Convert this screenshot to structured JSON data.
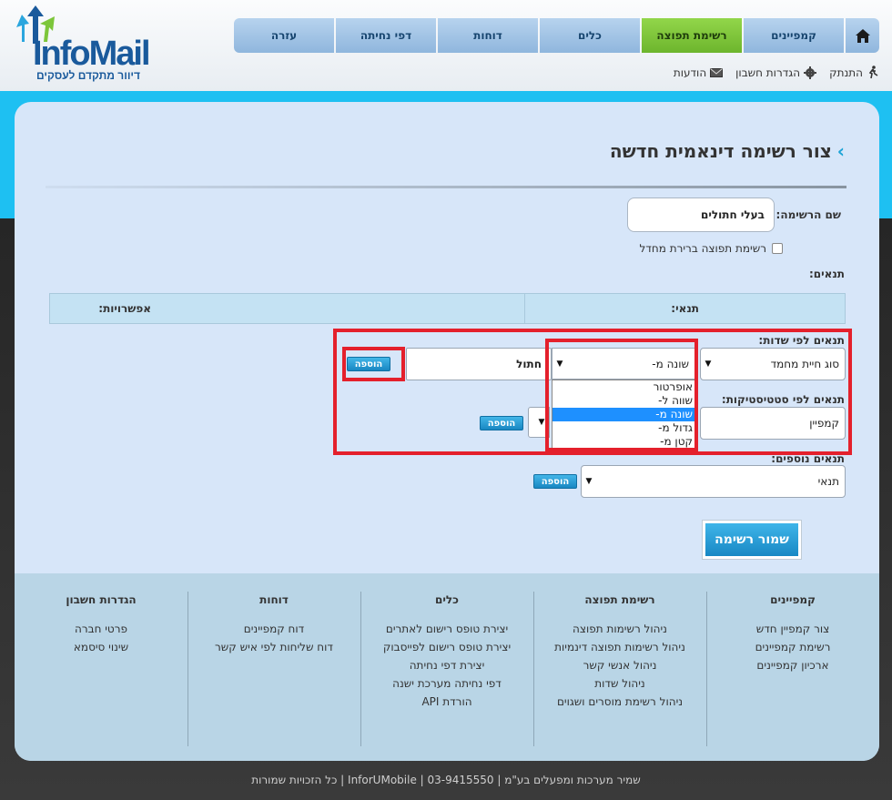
{
  "logo": {
    "part1": "Info",
    "part2": "Mail",
    "tagline": "דיוור מתקדם לעסקים"
  },
  "nav": {
    "tabs": [
      {
        "label": "קמפיינים"
      },
      {
        "label": "רשימת תפוצה"
      },
      {
        "label": "כלים"
      },
      {
        "label": "דוחות"
      },
      {
        "label": "דפי נחיתה"
      },
      {
        "label": "עזרה"
      }
    ],
    "active_tab": "רשימת תפוצה"
  },
  "subnav": {
    "messages": "הודעות",
    "settings": "הגדרות חשבון",
    "logout": "התנתק"
  },
  "page": {
    "title": "צור רשימה דינאמית חדשה"
  },
  "form": {
    "list_name_label": "שם הרשימה:",
    "list_name_value": "בעלי חתולים",
    "default_list_checkbox": "רשימת תפוצה ברירת מחדל",
    "conditions_label": "תנאים:",
    "table_headers": {
      "condition": "תנאי:",
      "options": "אפשרויות:"
    },
    "by_fields": {
      "label": "תנאים לפי שדות:",
      "field_select": "סוג חיית מחמד",
      "operator_select": "שונה מ-",
      "value_input": "חתול",
      "add_label": "הוספה"
    },
    "operator_options": [
      "אופרטור",
      "שווה ל-",
      "שונה מ-",
      "גדול מ-",
      "קטן מ-"
    ],
    "operator_selected_index": 2,
    "by_stats": {
      "label": "תנאים לפי סטטיסטיקות:",
      "campaign_select": "קמפיין",
      "add_label": "הוספה"
    },
    "extra": {
      "label": "תנאים נוספים:",
      "condition_select": "תנאי",
      "add_label": "הוספה"
    },
    "save_label": "שמור רשימה"
  },
  "footer": {
    "columns": [
      {
        "title": "קמפיינים",
        "links": [
          "צור קמפיין חדש",
          "רשימת קמפיינים",
          "ארכיון קמפיינים"
        ]
      },
      {
        "title": "רשימת תפוצה",
        "links": [
          "ניהול רשימות תפוצה",
          "ניהול רשימות תפוצה דינמיות",
          "ניהול אנשי קשר",
          "ניהול שדות",
          "ניהול רשימת מוסרים ושגוים"
        ]
      },
      {
        "title": "כלים",
        "links": [
          "יצירת טופס רישום לאתרים",
          "יצירת טופס רישום לפייסבוק",
          "יצירת דפי נחיתה",
          "דפי נחיתה מערכת ישנה",
          "הורדת API"
        ]
      },
      {
        "title": "דוחות",
        "links": [
          "דוח קמפיינים",
          "דוח שליחות לפי איש קשר"
        ]
      },
      {
        "title": "הגדרות חשבון",
        "links": [
          "פרטי חברה",
          "שינוי סיסמא"
        ]
      }
    ],
    "copyright": "שמיר מערכות ומפעלים בע\"מ | InforUMobile | 03-9415550 | כל הזכויות שמורות"
  },
  "colors": {
    "accent": "#1ec0f2",
    "active_tab": "#7cc63a",
    "highlight": "#e4202c"
  }
}
